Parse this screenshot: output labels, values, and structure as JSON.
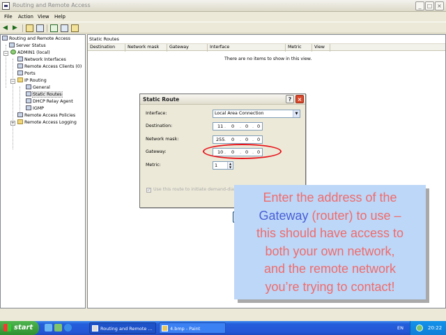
{
  "window": {
    "title": "Routing and Remote Access",
    "controls": [
      "_",
      "□",
      "×"
    ]
  },
  "menu": [
    "File",
    "Action",
    "View",
    "Help"
  ],
  "tree": {
    "items": [
      {
        "label": "Routing and Remote Access",
        "icon": "server-tree-icon"
      },
      {
        "label": "Server Status",
        "icon": "server-status-icon"
      },
      {
        "label": "ADMIN1 (local)",
        "icon": "server-online-icon"
      },
      {
        "label": "Network Interfaces",
        "icon": "network-interfaces-icon"
      },
      {
        "label": "Remote Access Clients (0)",
        "icon": "remote-clients-icon"
      },
      {
        "label": "Ports",
        "icon": "ports-icon"
      },
      {
        "label": "IP Routing",
        "icon": "folder-icon"
      },
      {
        "label": "General",
        "icon": "network-icon"
      },
      {
        "label": "Static Routes",
        "icon": "routes-icon"
      },
      {
        "label": "DHCP Relay Agent",
        "icon": "dhcp-icon"
      },
      {
        "label": "IGMP",
        "icon": "igmp-icon"
      },
      {
        "label": "Remote Access Policies",
        "icon": "policy-icon"
      },
      {
        "label": "Remote Access Logging",
        "icon": "folder-icon"
      }
    ]
  },
  "detail": {
    "title": "Static Routes",
    "columns": [
      "Destination",
      "Network mask",
      "Gateway",
      "Interface",
      "Metric",
      "View"
    ],
    "empty_message": "There are no items to show in this view."
  },
  "dialog": {
    "title": "Static Route",
    "help_button": "?",
    "close_button": "×",
    "interface_label": "Interface:",
    "interface_value": "Local Area Connection",
    "destination_label": "Destination:",
    "destination_value": [
      "11",
      "0",
      "0",
      "0"
    ],
    "netmask_label": "Network mask:",
    "netmask_value": [
      "255",
      "0",
      "0",
      "0"
    ],
    "gateway_label": "Gateway:",
    "gateway_value": [
      "10",
      "0",
      "0",
      "0"
    ],
    "metric_label": "Metric:",
    "metric_value": "1",
    "checkbox_label": "Use this route to initiate demand-dial co",
    "highlight_color": "#e8121a"
  },
  "callout": {
    "line1": "Enter the address of the",
    "keyword": "Gateway",
    "line2_rest": " (router) to use –",
    "line3": "this should have access to",
    "line4": "both your own network,",
    "line5": "and the remote network",
    "line6": "you’re trying to contact!",
    "bg_color": "#bcd7f8",
    "text_color": "#f06b6b",
    "keyword_color": "#4a5fd6"
  },
  "taskbar": {
    "start_label": "start",
    "tasks": [
      {
        "label": "Routing and Remote ...",
        "active": true
      },
      {
        "label": "4.bmp - Paint",
        "active": false
      }
    ],
    "language": "EN",
    "clock": "20:22"
  }
}
